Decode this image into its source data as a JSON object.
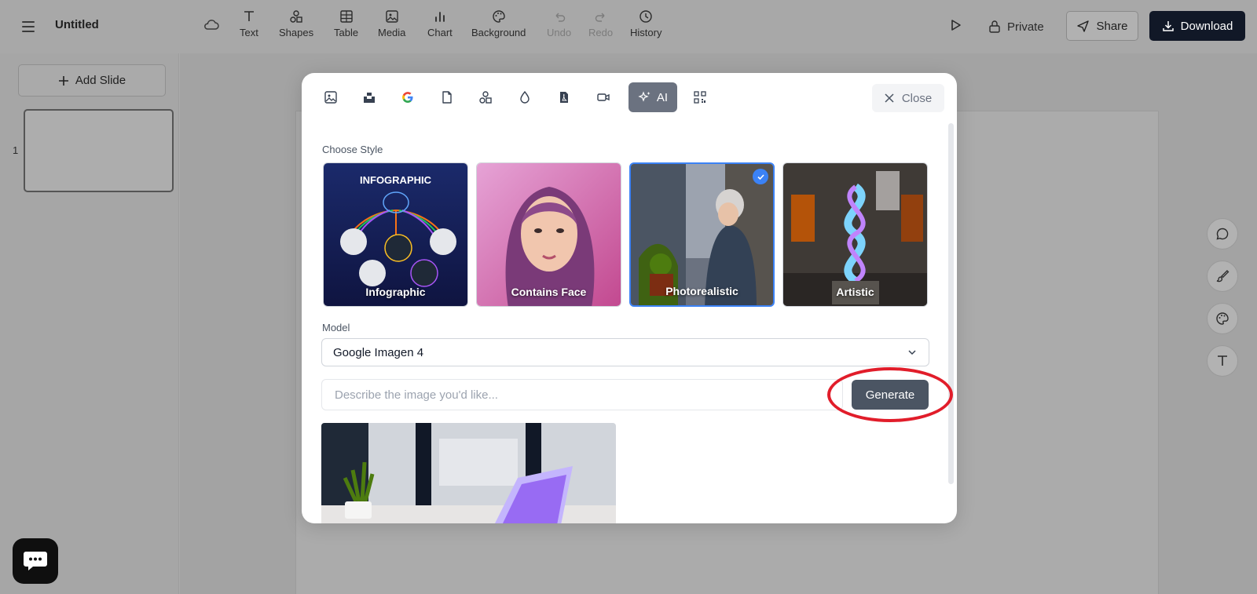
{
  "document": {
    "title": "Untitled"
  },
  "toolbar": {
    "items": [
      {
        "label": "Text"
      },
      {
        "label": "Shapes"
      },
      {
        "label": "Table"
      },
      {
        "label": "Media"
      },
      {
        "label": "Chart"
      },
      {
        "label": "Background"
      },
      {
        "label": "Undo"
      },
      {
        "label": "Redo"
      },
      {
        "label": "History"
      }
    ],
    "private_label": "Private",
    "share_label": "Share",
    "download_label": "Download"
  },
  "sidebar": {
    "add_slide_label": "Add Slide",
    "slides": [
      {
        "number": "1"
      }
    ]
  },
  "modal": {
    "ai_tab_label": "AI",
    "close_label": "Close",
    "choose_style_label": "Choose Style",
    "styles": [
      {
        "name": "Infographic",
        "heading": "INFOGRAPHIC"
      },
      {
        "name": "Contains Face"
      },
      {
        "name": "Photorealistic",
        "selected": true
      },
      {
        "name": "Artistic"
      }
    ],
    "model_label": "Model",
    "model_value": "Google Imagen 4",
    "prompt_placeholder": "Describe the image you'd like...",
    "generate_label": "Generate"
  },
  "colors": {
    "accent": "#3b82f6",
    "download_bg": "#111827",
    "generate_bg": "#4b5563",
    "highlight": "#e11d2a"
  }
}
